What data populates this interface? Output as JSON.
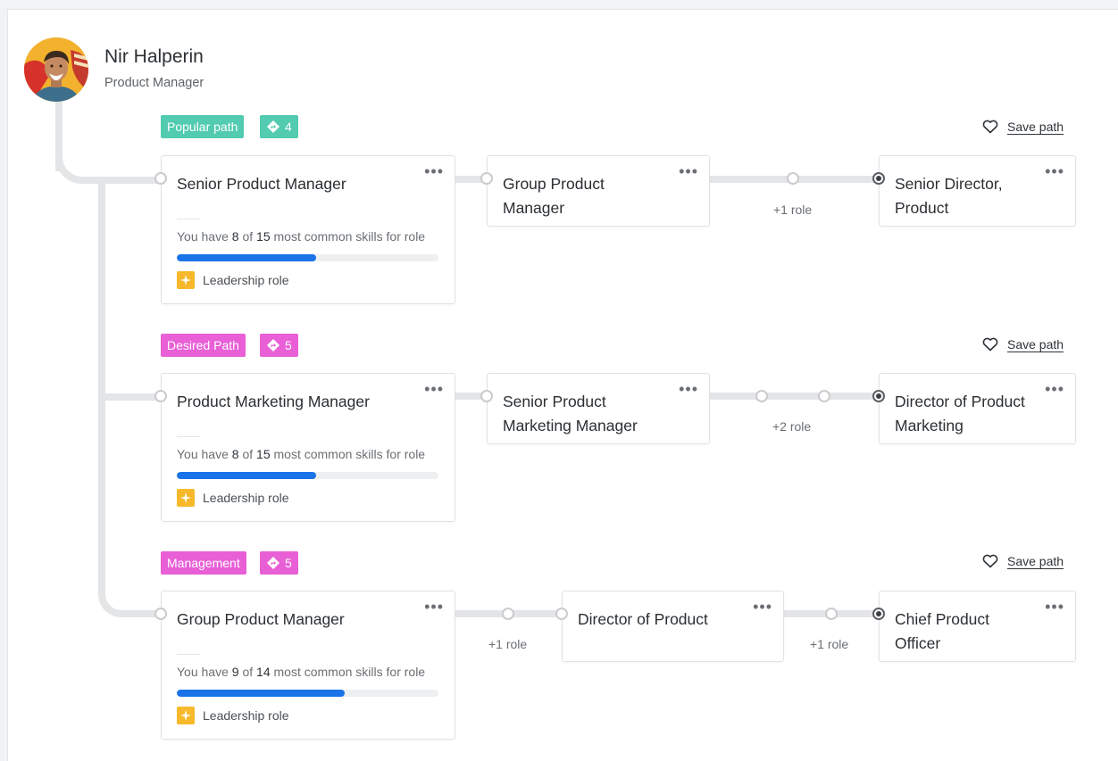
{
  "colors": {
    "popular": "#52cbb0",
    "desired": "#e85fd6",
    "management": "#e85fd6",
    "progress": "#1a73e8",
    "leadership_icon": "#f7b92b",
    "connector": "#e4e5e7"
  },
  "user": {
    "name": "Nir Halperin",
    "title": "Product Manager"
  },
  "paths": [
    {
      "tag": "Popular path",
      "count": "4",
      "save_label": "Save path",
      "first": {
        "title": "Senior Product Manager",
        "skills_prefix": "You have",
        "skills_have": "8",
        "skills_of": "of",
        "skills_total": "15",
        "skills_suffix": "most common skills for role",
        "progress": 0.533,
        "leadership": "Leadership role"
      },
      "second": {
        "title": "Group Product Manager"
      },
      "gap_label": "+1 role",
      "target": {
        "title": "Senior Director, Product"
      }
    },
    {
      "tag": "Desired Path",
      "count": "5",
      "save_label": "Save path",
      "first": {
        "title": "Product Marketing Manager",
        "skills_prefix": "You have",
        "skills_have": "8",
        "skills_of": "of",
        "skills_total": "15",
        "skills_suffix": "most common skills for role",
        "progress": 0.533,
        "leadership": "Leadership role"
      },
      "second": {
        "title": "Senior Product Marketing Manager"
      },
      "gap_label": "+2 role",
      "target": {
        "title": "Director of Product Marketing"
      }
    },
    {
      "tag": "Management",
      "count": "5",
      "save_label": "Save path",
      "first": {
        "title": "Group Product Manager",
        "skills_prefix": "You have",
        "skills_have": "9",
        "skills_of": "of",
        "skills_total": "14",
        "skills_suffix": "most common skills for role",
        "progress": 0.643,
        "leadership": "Leadership role"
      },
      "gap_label_1": "+1 role",
      "second": {
        "title": "Director of Product"
      },
      "gap_label_2": "+1 role",
      "target": {
        "title": "Chief Product Officer"
      }
    }
  ]
}
